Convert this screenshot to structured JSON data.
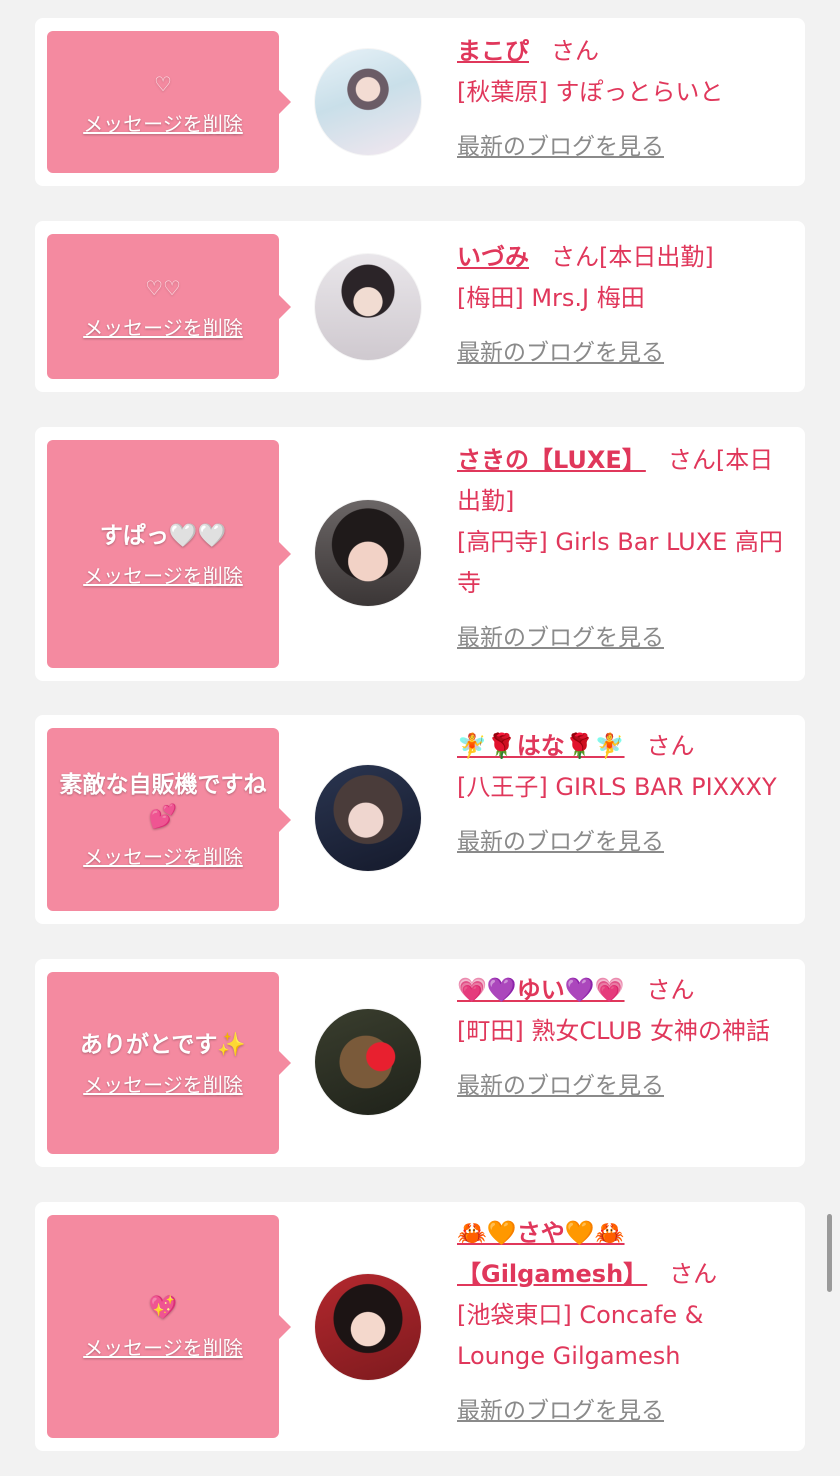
{
  "labels": {
    "delete": "メッセージを削除",
    "blog": "最新のブログを見る"
  },
  "cards": [
    {
      "message": "♡",
      "name": "まこぴ",
      "san": "さん",
      "shop": "[秋葉原] すぽっとらいと",
      "avatar": "avatar-photo-1"
    },
    {
      "message": "♡♡",
      "name": "いづみ",
      "san": "さん[本日出勤]",
      "shop": "[梅田] Mrs.J 梅田",
      "avatar": "avatar-photo-2"
    },
    {
      "message": "すぱっ🤍🤍",
      "name": "さきの【LUXE】",
      "san": "さん[本日出勤]",
      "shop": "[高円寺] Girls Bar LUXE 高円寺",
      "avatar": "avatar-photo-3"
    },
    {
      "message": "素敵な自販機ですね💕",
      "name": "🧚🌹はな🌹🧚",
      "san": "さん",
      "shop": "[八王子] GIRLS BAR PIXXXY",
      "avatar": "avatar-photo-4"
    },
    {
      "message": "ありがとです✨",
      "name": "💗💜ゆい💜💗",
      "san": "さん",
      "shop": "[町田] 熟女CLUB 女神の神話",
      "avatar": "avatar-photo-5"
    },
    {
      "message": "💖",
      "name": "🦀🧡さや🧡🦀【Gilgamesh】",
      "san": "さん",
      "shop": "[池袋東口] Concafe & Lounge Gilgamesh",
      "avatar": "avatar-photo-6"
    }
  ],
  "colors": {
    "bubble": "#f48aa0",
    "accent": "#e0375b",
    "link_gray": "#8a8a8a",
    "background": "#f2f2f2"
  }
}
